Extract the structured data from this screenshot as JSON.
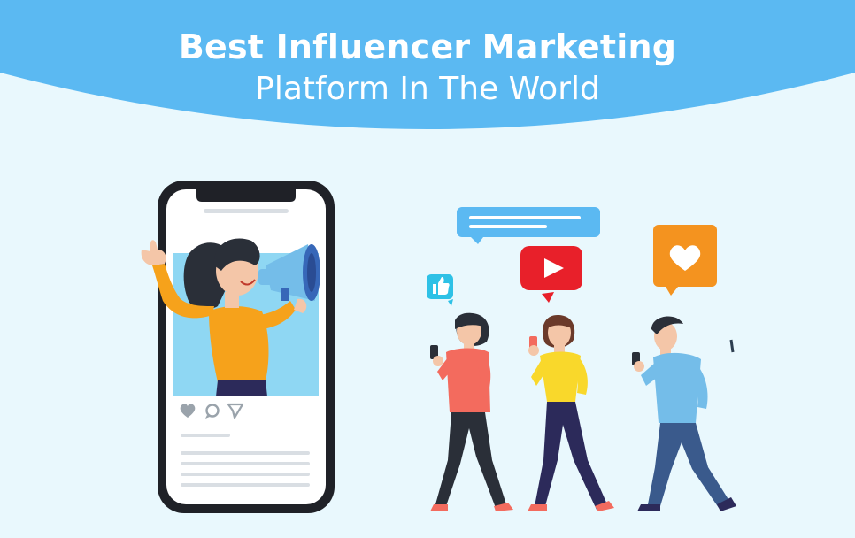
{
  "header": {
    "title_line1": "Best Influencer Marketing",
    "title_line2": "Platform In The World"
  },
  "colors": {
    "background": "#e9f8fd",
    "banner": "#5bb9f2",
    "phone_frame": "#1f2127",
    "post_image": "#8fd7f3",
    "youtube_red": "#e8202a",
    "like_orange": "#f4931f",
    "thumb_teal": "#2ec1e6",
    "chat_blue": "#5bb9f2",
    "influencer_top": "#f6a21b",
    "person1_top": "#f36b5e",
    "person2_top": "#f9d82b",
    "person3_top": "#74bde9"
  },
  "icons": {
    "post_actions": [
      "heart-icon",
      "comment-icon",
      "send-icon"
    ],
    "reactions": [
      "thumbs-up-icon",
      "youtube-play-icon",
      "heart-icon",
      "chat-bubble-icon"
    ]
  }
}
